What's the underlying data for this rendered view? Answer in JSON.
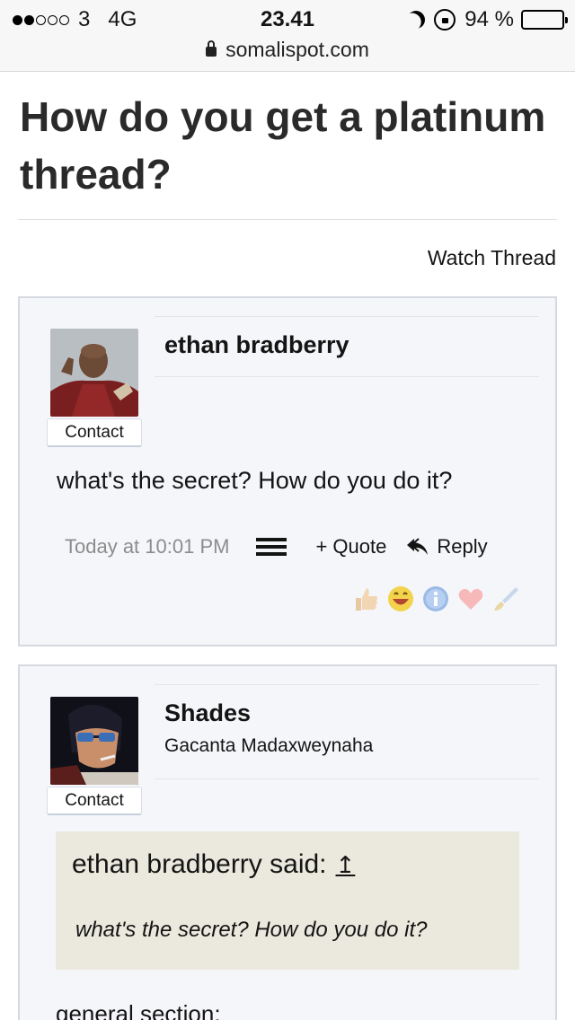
{
  "status_bar": {
    "carrier": "3",
    "network": "4G",
    "time": "23.41",
    "battery": "94 %",
    "battery_level": 0.94
  },
  "browser": {
    "url": "somalispot.com"
  },
  "thread": {
    "title": "How do you get a platinum thread?",
    "watch_label": "Watch Thread"
  },
  "posts": [
    {
      "author": "ethan bradberry",
      "contact_label": "Contact",
      "message": "what's the secret? How do you do it?",
      "date": "Today at 10:01 PM",
      "quote_label": "+ Quote",
      "reply_label": "Reply",
      "reactions": [
        "like-icon",
        "funny-icon",
        "informative-icon",
        "love-icon",
        "brush-icon"
      ]
    },
    {
      "author": "Shades",
      "user_title": "Gacanta Madaxweynaha",
      "contact_label": "Contact",
      "quote": {
        "attribution": "ethan bradberry said:",
        "jump_glyph": "↥",
        "text": "what's the secret? How do you do it?"
      },
      "message_start": "general section;"
    }
  ],
  "colors": {
    "post_bg": "#f5f6fa",
    "post_border": "#d5d9e0",
    "quote_bg": "#ebe9dd",
    "date_text": "#8c8c8c"
  }
}
